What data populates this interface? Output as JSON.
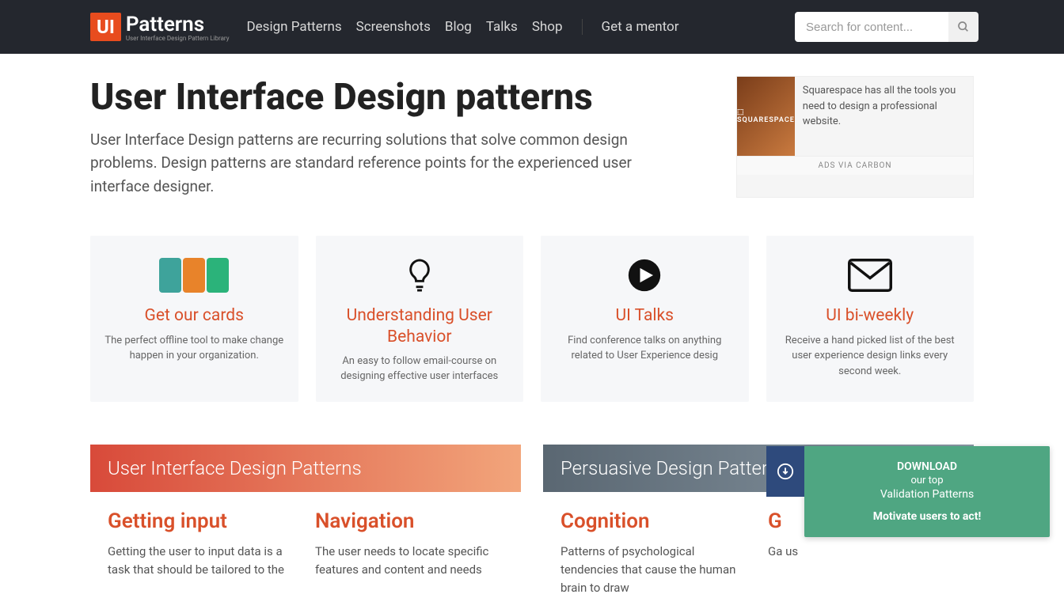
{
  "logo": {
    "ui": "UI",
    "text": "Patterns",
    "sub": "User Interface Design Pattern Library"
  },
  "nav": [
    "Design Patterns",
    "Screenshots",
    "Blog",
    "Talks",
    "Shop"
  ],
  "mentor": "Get a mentor",
  "search": {
    "placeholder": "Search for content..."
  },
  "hero": {
    "title": "User Interface Design patterns",
    "desc": "User Interface Design patterns are recurring solutions that solve common design problems. Design patterns are standard reference points for the experienced user interface designer."
  },
  "ad": {
    "brand": "⬚ SQUARESPACE",
    "text": "Squarespace has all the tools you need to design a professional website.",
    "via": "ADS VIA CARBON"
  },
  "promos": [
    {
      "title": "Get our cards",
      "desc": "The perfect offline tool to make change happen in your organization."
    },
    {
      "title": "Understanding User Behavior",
      "desc": "An easy to follow email-course on designing effective user interfaces"
    },
    {
      "title": "UI Talks",
      "desc": "Find conference talks on anything related to User Experience desig"
    },
    {
      "title": "UI bi-weekly",
      "desc": "Receive a hand picked list of the best user experience design links every second week."
    }
  ],
  "sections": [
    {
      "header": "User Interface Design Patterns",
      "cols": [
        {
          "title": "Getting input",
          "desc": "Getting the user to input data is a task that should be tailored to the"
        },
        {
          "title": "Navigation",
          "desc": "The user needs to locate specific features and content and needs"
        }
      ]
    },
    {
      "header": "Persuasive Design Patterns",
      "cols": [
        {
          "title": "Cognition",
          "desc": "Patterns of psychological tendencies that cause the human brain to draw"
        },
        {
          "title": "G",
          "desc": "Ga\nus"
        }
      ]
    }
  ],
  "popup": {
    "line1": "DOWNLOAD",
    "line2": "our top",
    "line3": "Validation Patterns",
    "cta": "Motivate users to act!"
  }
}
